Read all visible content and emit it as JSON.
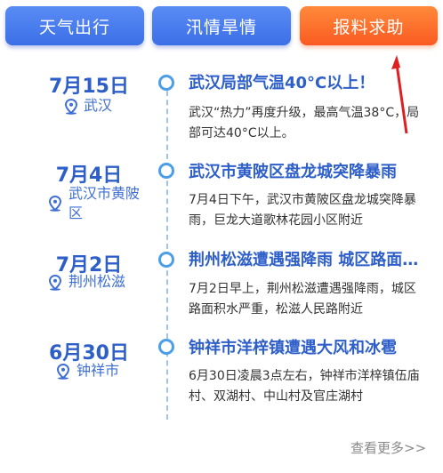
{
  "tabs": [
    {
      "label": "天气出行"
    },
    {
      "label": "汛情旱情"
    },
    {
      "label": "报料求助"
    }
  ],
  "entries": [
    {
      "date": "7月15日",
      "location": "武汉",
      "title": "武汉局部气温40°C以上！",
      "desc": "武汉“热力”再度升级，最高气温38°C，局部可达40°C以上。"
    },
    {
      "date": "7月4日",
      "location": "武汉市黄陂区",
      "title": "武汉市黄陂区盘龙城突降暴雨",
      "desc": "7月4日下午，武汉市黄陂区盘龙城突降暴雨，巨龙大道歌林花园小区附近"
    },
    {
      "date": "7月2日",
      "location": "荆州松滋",
      "title": "荆州松滋遭遇强降雨 城区路面积水",
      "desc": "7月2日早上，荆州松滋遭遇强降雨，城区路面积水严重，松滋人民路附近"
    },
    {
      "date": "6月30日",
      "location": "钟祥市",
      "title": "钟祥市洋梓镇遭遇大风和冰雹",
      "desc": "6月30日凌晨3点左右，钟祥市洋梓镇伍庙村、双湖村、中山村及官庄湖村"
    }
  ],
  "more_link": "查看更多>>",
  "colors": {
    "accent_blue": "#2e5fc9",
    "tab_blue": "#3b6fe6",
    "tab_orange": "#fb5a22",
    "annotation_red": "#e02020"
  }
}
